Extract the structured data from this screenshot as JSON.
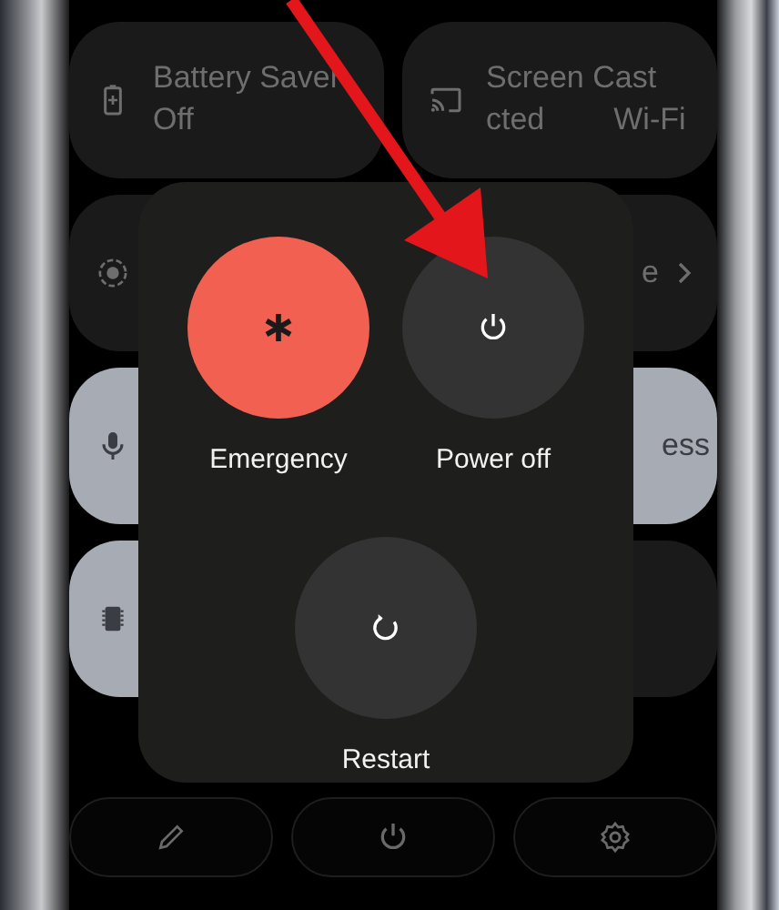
{
  "tiles": [
    {
      "kind": "battery",
      "label": "Battery Saver",
      "status": "Off",
      "on": false
    },
    {
      "kind": "cast",
      "label": "Screen Cast",
      "status": "cted",
      "detail": "Wi-Fi",
      "on": false
    },
    {
      "kind": "record",
      "on": false
    },
    {
      "kind": "none",
      "label": "e",
      "chevron": true,
      "on": false
    },
    {
      "kind": "mic",
      "on": true
    },
    {
      "kind": "none",
      "label": "ess",
      "on": true
    },
    {
      "kind": "chip",
      "on": true
    },
    {
      "kind": "none",
      "on": false
    }
  ],
  "power_menu": {
    "options": [
      {
        "kind": "emergency",
        "label": "Emergency"
      },
      {
        "kind": "power",
        "label": "Power off"
      },
      {
        "kind": "restart",
        "label": "Restart"
      }
    ]
  },
  "bottom_bar": [
    {
      "kind": "edit"
    },
    {
      "kind": "power"
    },
    {
      "kind": "settings"
    }
  ]
}
